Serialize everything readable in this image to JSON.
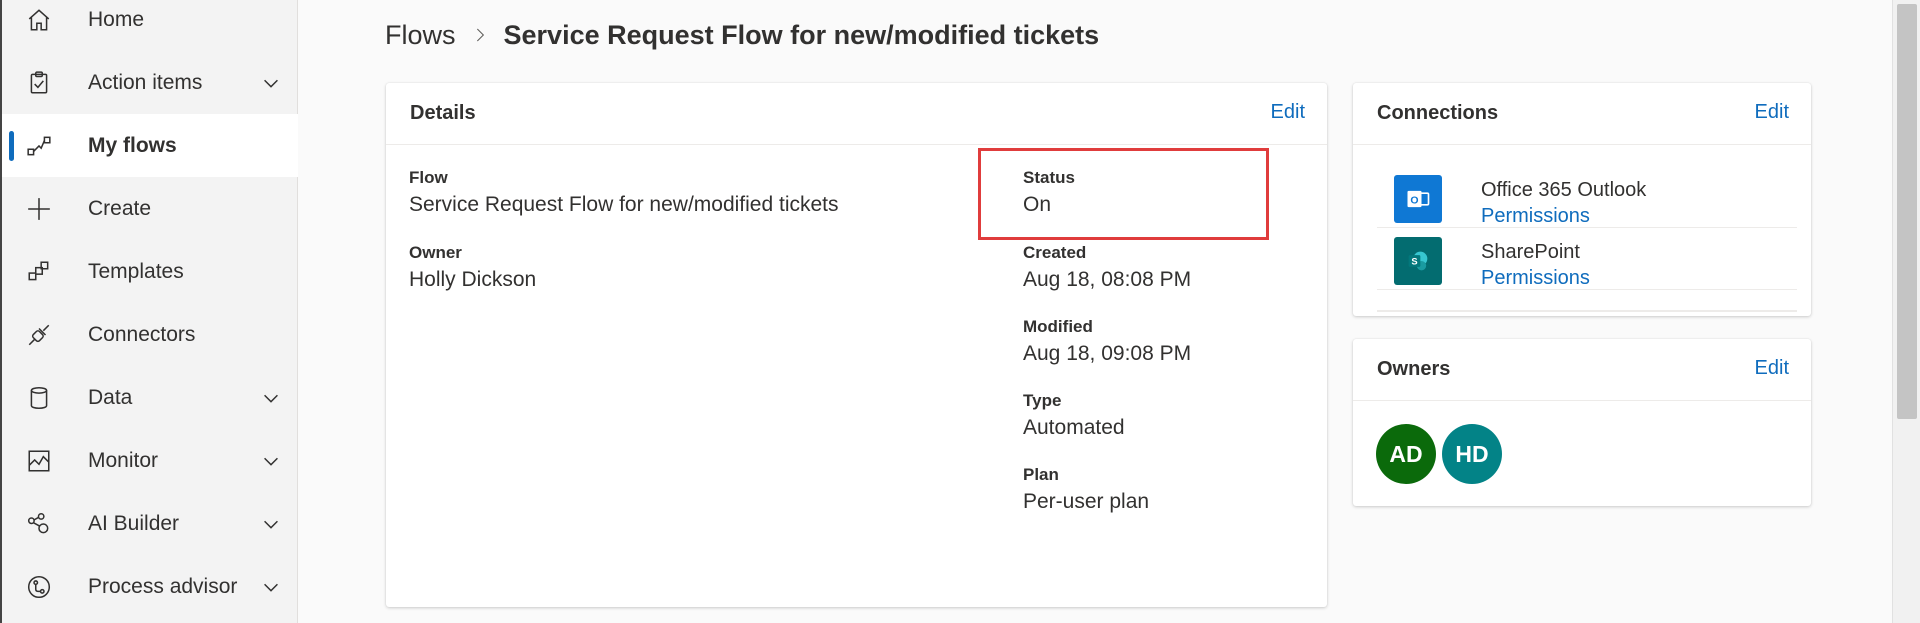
{
  "sidebar": {
    "items": [
      {
        "label": "Home",
        "icon": "home-icon",
        "has_chevron": false,
        "active": false
      },
      {
        "label": "Action items",
        "icon": "clipboard-icon",
        "has_chevron": true,
        "active": false
      },
      {
        "label": "My flows",
        "icon": "flow-icon",
        "has_chevron": false,
        "active": true
      },
      {
        "label": "Create",
        "icon": "plus-icon",
        "has_chevron": false,
        "active": false
      },
      {
        "label": "Templates",
        "icon": "templates-icon",
        "has_chevron": false,
        "active": false
      },
      {
        "label": "Connectors",
        "icon": "connector-icon",
        "has_chevron": false,
        "active": false
      },
      {
        "label": "Data",
        "icon": "database-icon",
        "has_chevron": true,
        "active": false
      },
      {
        "label": "Monitor",
        "icon": "monitor-icon",
        "has_chevron": true,
        "active": false
      },
      {
        "label": "AI Builder",
        "icon": "ai-builder-icon",
        "has_chevron": true,
        "active": false
      },
      {
        "label": "Process advisor",
        "icon": "process-advisor-icon",
        "has_chevron": true,
        "active": false
      }
    ]
  },
  "breadcrumb": {
    "parent": "Flows",
    "current": "Service Request Flow for new/modified tickets"
  },
  "details": {
    "title": "Details",
    "edit_label": "Edit",
    "flow_label": "Flow",
    "flow_value": "Service Request Flow for new/modified tickets",
    "owner_label": "Owner",
    "owner_value": "Holly Dickson",
    "status_label": "Status",
    "status_value": "On",
    "created_label": "Created",
    "created_value": "Aug 18, 08:08 PM",
    "modified_label": "Modified",
    "modified_value": "Aug 18, 09:08 PM",
    "type_label": "Type",
    "type_value": "Automated",
    "plan_label": "Plan",
    "plan_value": "Per-user plan"
  },
  "connections": {
    "title": "Connections",
    "edit_label": "Edit",
    "items": [
      {
        "name": "Office 365 Outlook",
        "permissions_label": "Permissions",
        "icon": "outlook-icon",
        "color": "#0f78d4"
      },
      {
        "name": "SharePoint",
        "permissions_label": "Permissions",
        "icon": "sharepoint-icon",
        "color": "#036c70"
      }
    ]
  },
  "owners": {
    "title": "Owners",
    "edit_label": "Edit",
    "avatars": [
      {
        "initials": "AD",
        "color": "#0b6a0b"
      },
      {
        "initials": "HD",
        "color": "#038387"
      }
    ]
  },
  "colors": {
    "accent": "#0f6cbd",
    "highlight": "#e03c3c"
  }
}
